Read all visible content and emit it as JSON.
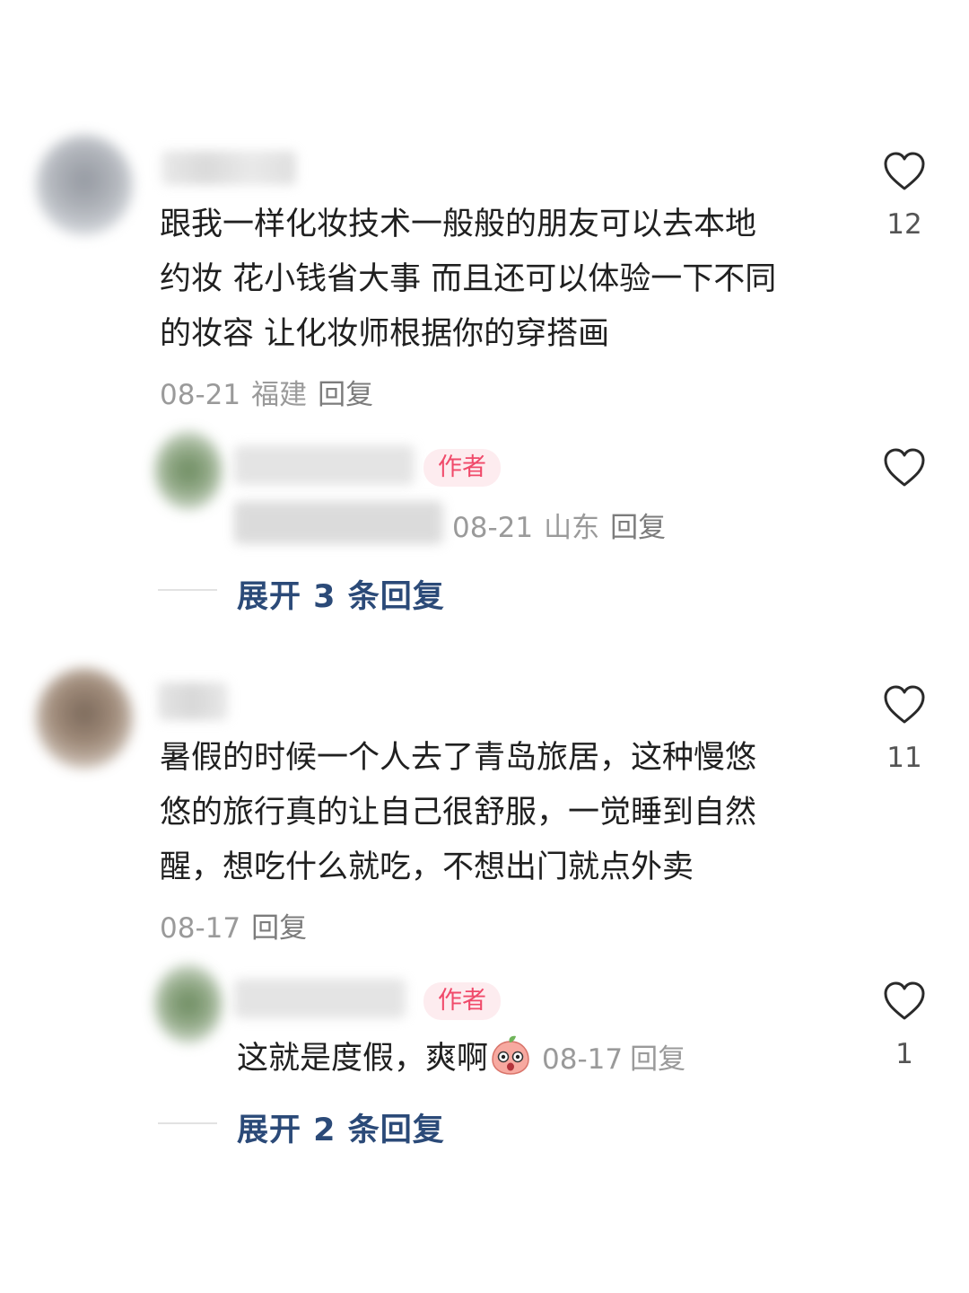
{
  "comments": [
    {
      "text_lines": [
        "跟我一样化妆技术一般般的朋友可以去本地",
        "约妆 花小钱省大事 而且还可以体验一下不同",
        "的妆容 让化妆师根据你的穿搭画"
      ],
      "date": "08-21",
      "location": "福建",
      "reply_label": "回复",
      "likes": "12",
      "author_reply": {
        "badge": "作者",
        "date": "08-21",
        "location": "山东",
        "reply_label": "回复"
      },
      "expand_label": "展开 3 条回复"
    },
    {
      "text_lines": [
        "暑假的时候一个人去了青岛旅居，这种慢悠",
        "悠的旅行真的让自己很舒服，一觉睡到自然",
        "醒，想吃什么就吃，不想出门就点外卖"
      ],
      "date": "08-17",
      "reply_label": "回复",
      "likes": "11",
      "author_reply": {
        "badge": "作者",
        "text": "这就是度假，爽啊",
        "emoji": "peach-face-emoji",
        "date": "08-17",
        "reply_label": "回复",
        "likes": "1"
      },
      "expand_label": "展开 2 条回复"
    }
  ],
  "colors": {
    "expand_text": "#2b4a78",
    "badge_text": "#f04a6a",
    "badge_bg": "#fdecef",
    "meta_text": "#9a9a9a"
  }
}
